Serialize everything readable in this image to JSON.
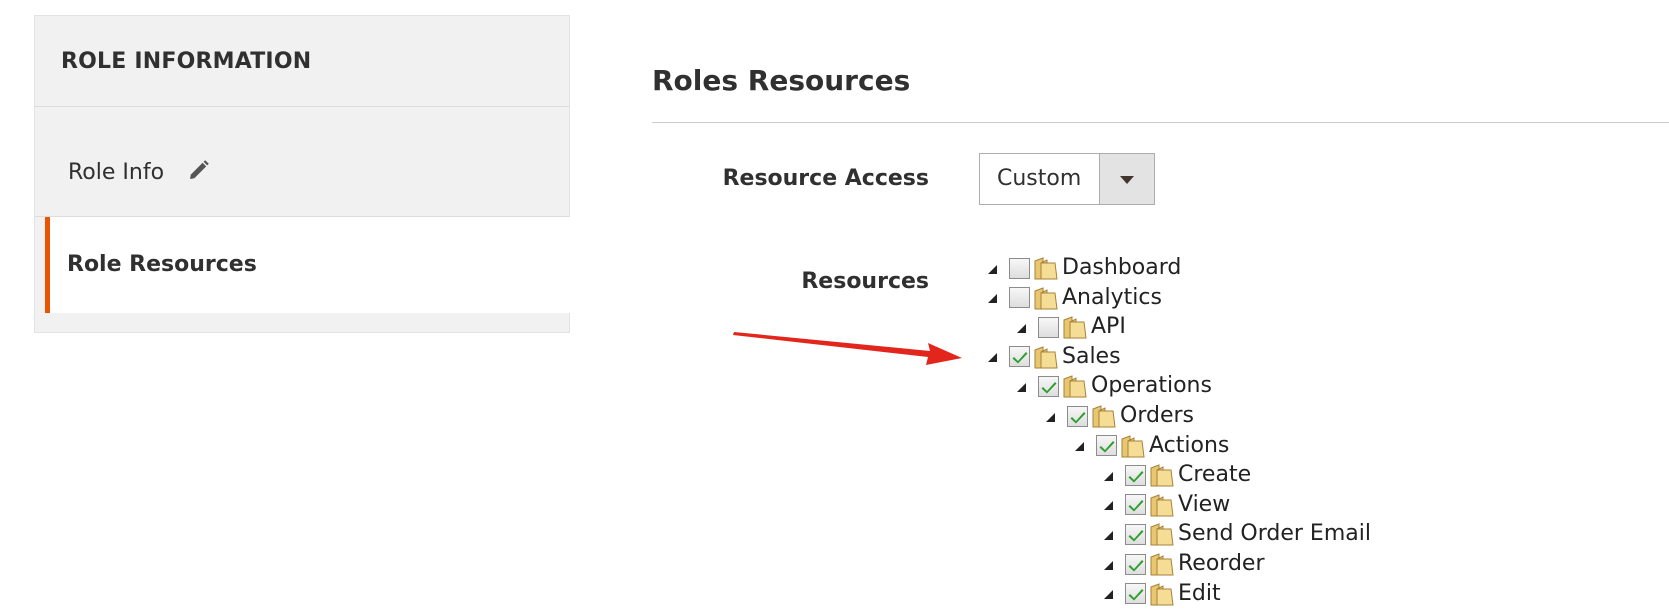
{
  "sidebar": {
    "title": "ROLE INFORMATION",
    "tabs": [
      {
        "label": "Role Info",
        "icon": "pencil-icon",
        "active": false
      },
      {
        "label": "Role Resources",
        "active": true
      }
    ]
  },
  "main": {
    "section_title": "Roles Resources",
    "resource_access": {
      "label": "Resource Access",
      "selected": "Custom"
    },
    "resources": {
      "label": "Resources",
      "tree": [
        {
          "label": "Dashboard",
          "level": 0,
          "checked": false
        },
        {
          "label": "Analytics",
          "level": 0,
          "checked": false
        },
        {
          "label": "API",
          "level": 1,
          "checked": false
        },
        {
          "label": "Sales",
          "level": 0,
          "checked": true
        },
        {
          "label": "Operations",
          "level": 1,
          "checked": true
        },
        {
          "label": "Orders",
          "level": 2,
          "checked": true
        },
        {
          "label": "Actions",
          "level": 3,
          "checked": true
        },
        {
          "label": "Create",
          "level": 4,
          "checked": true
        },
        {
          "label": "View",
          "level": 4,
          "checked": true
        },
        {
          "label": "Send Order Email",
          "level": 4,
          "checked": true
        },
        {
          "label": "Reorder",
          "level": 4,
          "checked": true
        },
        {
          "label": "Edit",
          "level": 4,
          "checked": true
        }
      ]
    }
  },
  "colors": {
    "accent": "#eb5202",
    "annotation_arrow": "#e3261c",
    "check": "#2e9e2e"
  }
}
